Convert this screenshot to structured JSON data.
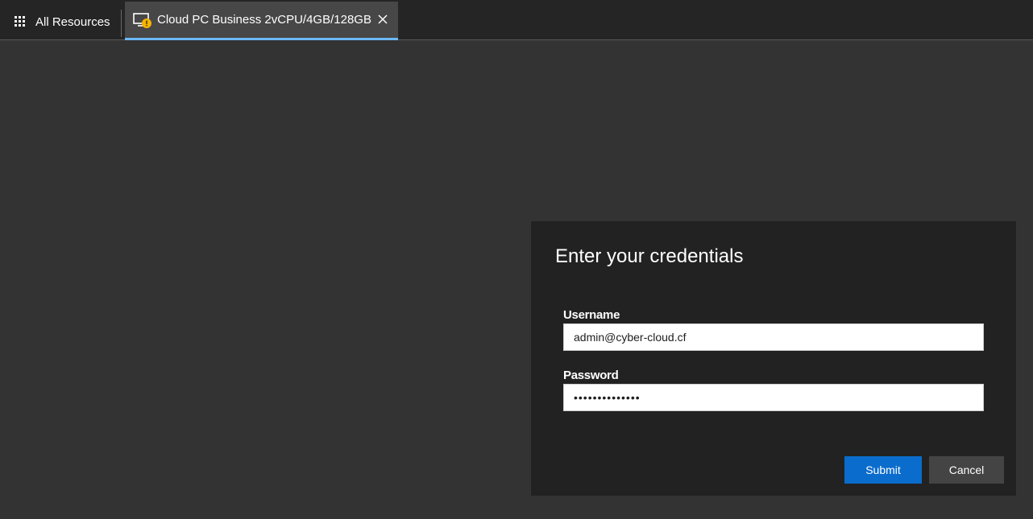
{
  "header": {
    "all_resources_label": "All Resources",
    "tab": {
      "label": "Cloud PC Business 2vCPU/4GB/128GB",
      "icon": "monitor-warning-icon",
      "close_icon": "close-icon",
      "active_indicator_color": "#6cb8f6"
    }
  },
  "dialog": {
    "title": "Enter your credentials",
    "username": {
      "label": "Username",
      "value": "admin@cyber-cloud.cf"
    },
    "password": {
      "label": "Password",
      "value": "••••••••••••••"
    },
    "submit_label": "Submit",
    "cancel_label": "Cancel",
    "submit_color": "#0a6ccc"
  },
  "colors": {
    "background": "#333333",
    "topbar": "#252525",
    "dialog": "#222222",
    "warning": "#f5b400"
  }
}
